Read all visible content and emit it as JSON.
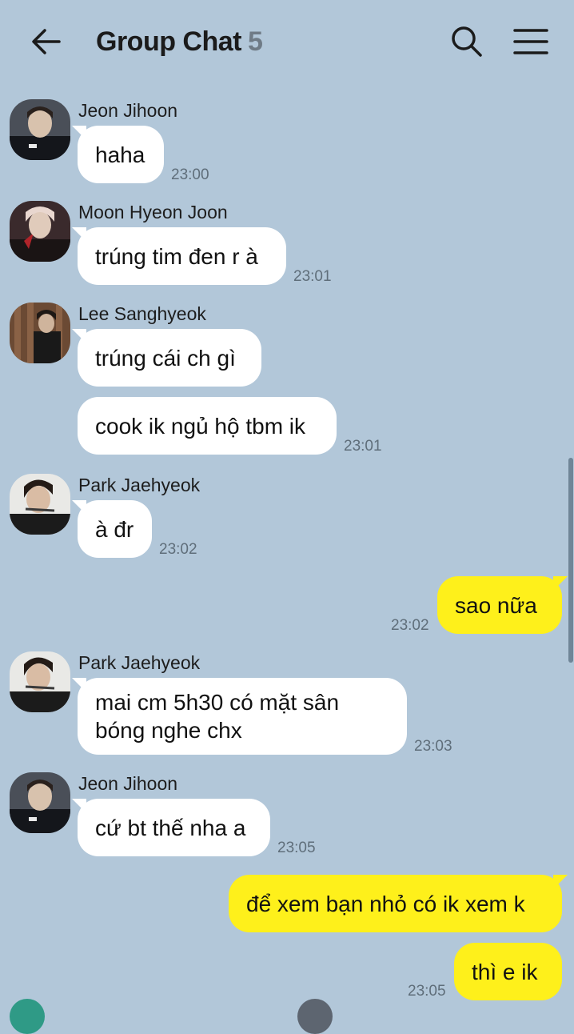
{
  "header": {
    "title": "Group Chat",
    "member_count": "5",
    "icons": {
      "back": "arrow-left-icon",
      "search": "search-icon",
      "menu": "hamburger-menu-icon"
    }
  },
  "colors": {
    "background": "#b2c7d9",
    "incoming_bubble": "#ffffff",
    "outgoing_bubble": "#fef01b",
    "timestamp": "#5f6e7a"
  },
  "messages": [
    {
      "sender": "Jeon Jihoon",
      "text": "haha",
      "time": "23:00"
    },
    {
      "sender": "Moon Hyeon Joon",
      "text": "trúng tim đen r à",
      "time": "23:01"
    },
    {
      "sender": "Lee Sanghyeok",
      "text": "trúng cái ch gì",
      "time": ""
    },
    {
      "sender": "",
      "text": "cook ik ngủ hộ tbm ik",
      "time": "23:01"
    },
    {
      "sender": "Park Jaehyeok",
      "text": "à đr",
      "time": "23:02"
    },
    {
      "sender": "me",
      "text": "sao nữa",
      "time": "23:02"
    },
    {
      "sender": "Park Jaehyeok",
      "text": "mai cm 5h30 có mặt sân bóng nghe chx",
      "time": "23:03"
    },
    {
      "sender": "Jeon Jihoon",
      "text": "cứ bt thế nha a",
      "time": "23:05"
    },
    {
      "sender": "me",
      "text": "để xem bạn nhỏ có ik xem k",
      "time": ""
    },
    {
      "sender": "me",
      "text": "thì e ik",
      "time": "23:05"
    }
  ]
}
